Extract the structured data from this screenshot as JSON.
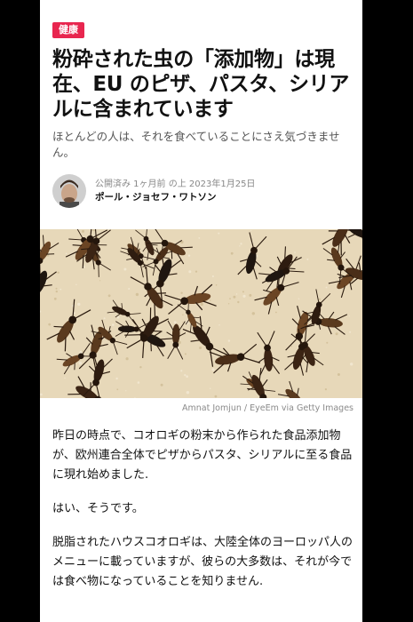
{
  "article": {
    "category": "健康",
    "headline": "粉砕された虫の「添加物」は現在、EU のピザ、パスタ、シリアルに含まれています",
    "subtitle": "ほとんどの人は、それを食べていることにさえ気づきません。",
    "meta": "公開済み 1ヶ月前 の上 2023年1月25日",
    "author": "ポール・ジョセフ・ワトソン",
    "image_credit": "Amnat Jomjun / EyeEm via Getty Images",
    "paragraphs": [
      "昨日の時点で、コオロギの粉末から作られた食品添加物が、欧州連合全体でピザからパスタ、シリアルに至る食品に現れ始めました.",
      "はい、そうです。",
      "脱脂されたハウスコオロギは、大陸全体のヨーロッパ人のメニューに載っていますが、彼らの大多数は、それが今では食べ物になっていることを知りません."
    ]
  },
  "colors": {
    "badge": "#e8264f",
    "background": "#000000",
    "page": "#ffffff"
  }
}
